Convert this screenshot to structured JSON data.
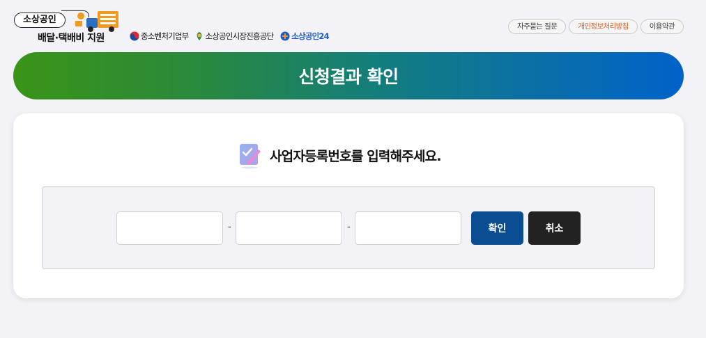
{
  "header": {
    "logo_badge": "소상공인",
    "logo_subtitle": "배달·택배비 지원",
    "orgs": [
      {
        "label": "중소벤처기업부"
      },
      {
        "label": "소상공인시장진흥공단"
      },
      {
        "label": "소상공인24"
      }
    ],
    "links": [
      {
        "label": "자주묻는 질문"
      },
      {
        "label": "개인정보처리방침"
      },
      {
        "label": "이용약관"
      }
    ]
  },
  "banner": {
    "title": "신청결과 확인"
  },
  "form": {
    "prompt": "사업자등록번호를 입력해주세요.",
    "part1": "",
    "part2": "",
    "part3": "",
    "separator": "-",
    "confirm_label": "확인",
    "cancel_label": "취소"
  },
  "colors": {
    "banner_start": "#3a9418",
    "banner_end": "#0062c9",
    "confirm_button": "#0a4d92",
    "cancel_button": "#222222",
    "policy_link": "#d9622b"
  }
}
